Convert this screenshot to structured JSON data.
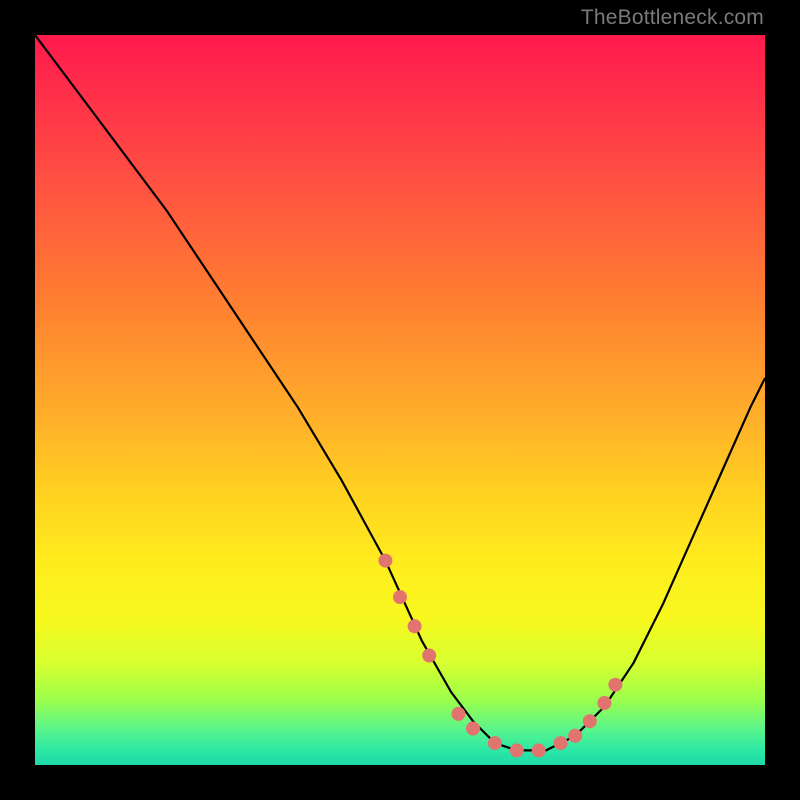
{
  "watermark": "TheBottleneck.com",
  "chart_data": {
    "type": "line",
    "title": "",
    "xlabel": "",
    "ylabel": "",
    "xlim": [
      0,
      100
    ],
    "ylim": [
      0,
      100
    ],
    "series": [
      {
        "name": "curve",
        "x": [
          0,
          6,
          12,
          18,
          24,
          30,
          36,
          42,
          48,
          53,
          57,
          60,
          63,
          66,
          70,
          74,
          78,
          82,
          86,
          90,
          94,
          98,
          100
        ],
        "values": [
          100,
          92,
          84,
          76,
          67,
          58,
          49,
          39,
          28,
          17,
          10,
          6,
          3,
          2,
          2,
          4,
          8,
          14,
          22,
          31,
          40,
          49,
          53
        ]
      }
    ],
    "markers": {
      "name": "highlight-dots",
      "color": "#e2746f",
      "x": [
        48,
        50,
        52,
        54,
        58,
        60,
        63,
        66,
        69,
        72,
        74,
        76,
        78,
        79.5
      ],
      "values": [
        28,
        23,
        19,
        15,
        7,
        5,
        3,
        2,
        2,
        3,
        4,
        6,
        8.5,
        11
      ]
    },
    "gradient_stops": [
      {
        "pos": 0,
        "color": "#ff1a4d"
      },
      {
        "pos": 22,
        "color": "#ff5640"
      },
      {
        "pos": 52,
        "color": "#ffae2a"
      },
      {
        "pos": 80,
        "color": "#f7f81e"
      },
      {
        "pos": 95,
        "color": "#5cf58a"
      },
      {
        "pos": 100,
        "color": "#1fd8a8"
      }
    ]
  }
}
